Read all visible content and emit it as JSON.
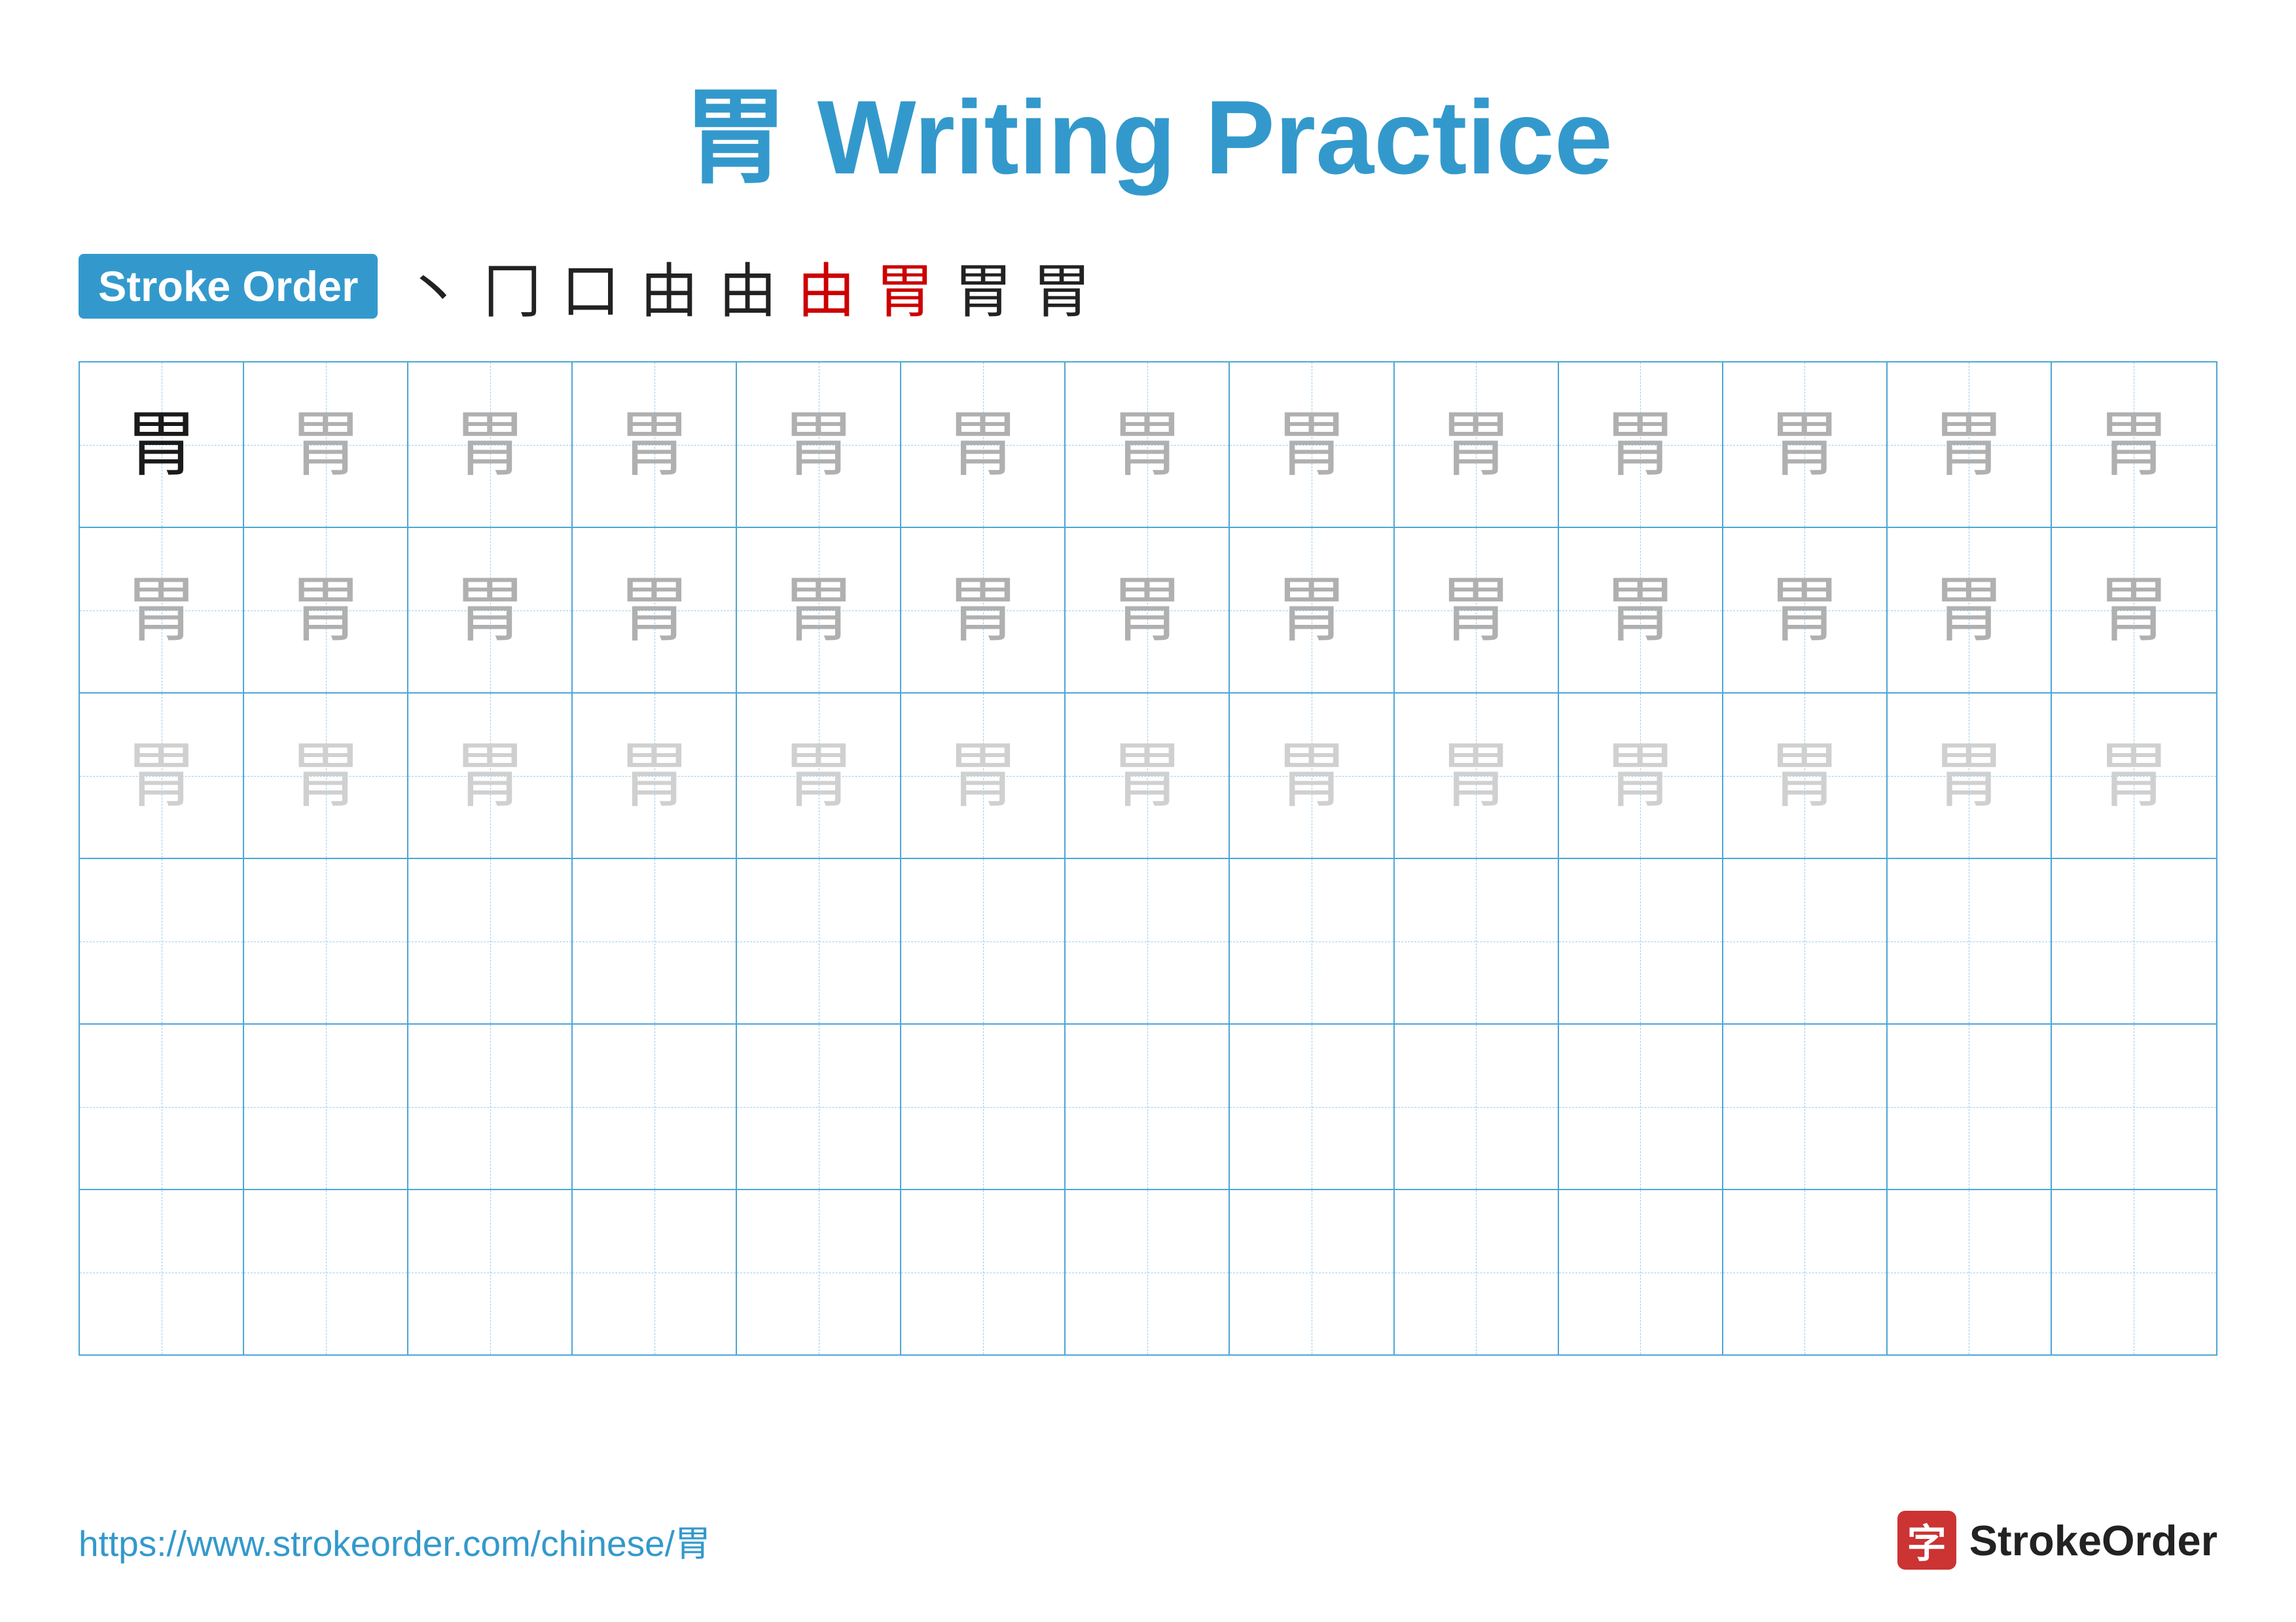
{
  "title": {
    "char": "胃",
    "text": "Writing Practice",
    "full": "胃 Writing Practice"
  },
  "stroke_order": {
    "badge_label": "Stroke Order",
    "steps": [
      "丶",
      "冂",
      "口",
      "由",
      "由",
      "由",
      "胃",
      "胃",
      "胃"
    ]
  },
  "grid": {
    "cols": 13,
    "rows": 6,
    "char": "胃",
    "row_data": [
      {
        "cells": [
          {
            "shade": "dark"
          },
          {
            "shade": "medium-gray"
          },
          {
            "shade": "medium-gray"
          },
          {
            "shade": "medium-gray"
          },
          {
            "shade": "medium-gray"
          },
          {
            "shade": "medium-gray"
          },
          {
            "shade": "medium-gray"
          },
          {
            "shade": "medium-gray"
          },
          {
            "shade": "medium-gray"
          },
          {
            "shade": "medium-gray"
          },
          {
            "shade": "medium-gray"
          },
          {
            "shade": "medium-gray"
          },
          {
            "shade": "medium-gray"
          }
        ]
      },
      {
        "cells": [
          {
            "shade": "medium-gray"
          },
          {
            "shade": "medium-gray"
          },
          {
            "shade": "medium-gray"
          },
          {
            "shade": "medium-gray"
          },
          {
            "shade": "medium-gray"
          },
          {
            "shade": "medium-gray"
          },
          {
            "shade": "medium-gray"
          },
          {
            "shade": "medium-gray"
          },
          {
            "shade": "medium-gray"
          },
          {
            "shade": "medium-gray"
          },
          {
            "shade": "medium-gray"
          },
          {
            "shade": "medium-gray"
          },
          {
            "shade": "medium-gray"
          }
        ]
      },
      {
        "cells": [
          {
            "shade": "light-gray"
          },
          {
            "shade": "light-gray"
          },
          {
            "shade": "light-gray"
          },
          {
            "shade": "light-gray"
          },
          {
            "shade": "light-gray"
          },
          {
            "shade": "light-gray"
          },
          {
            "shade": "light-gray"
          },
          {
            "shade": "light-gray"
          },
          {
            "shade": "light-gray"
          },
          {
            "shade": "light-gray"
          },
          {
            "shade": "light-gray"
          },
          {
            "shade": "light-gray"
          },
          {
            "shade": "light-gray"
          }
        ]
      },
      {
        "cells": "empty"
      },
      {
        "cells": "empty"
      },
      {
        "cells": "empty"
      }
    ]
  },
  "footer": {
    "url": "https://www.strokeorder.com/chinese/胃",
    "logo_char": "字",
    "logo_text": "StrokeOrder"
  }
}
